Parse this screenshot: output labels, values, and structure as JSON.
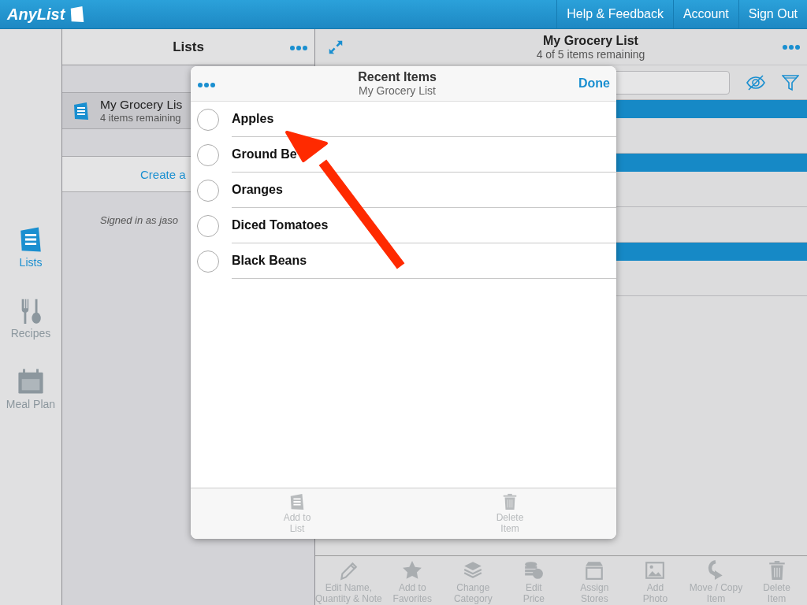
{
  "top_bar": {
    "logo": "AnyList",
    "links": [
      "Help & Feedback",
      "Account",
      "Sign Out"
    ]
  },
  "nav": [
    {
      "label": "Lists",
      "selected": true
    },
    {
      "label": "Recipes",
      "selected": false
    },
    {
      "label": "Meal Plan",
      "selected": false
    }
  ],
  "lists_pane": {
    "title": "Lists",
    "lists": [
      {
        "name": "My Grocery Lis",
        "subtitle": "4 items remaining",
        "selected": true
      }
    ],
    "create_link": "Create a",
    "signed_in": "Signed in as jaso"
  },
  "detail": {
    "title": "My Grocery List",
    "subtitle": "4 of 5 items remaining",
    "rows": [
      {
        "kind": "header"
      },
      {
        "kind": "item"
      },
      {
        "kind": "header"
      },
      {
        "kind": "item"
      },
      {
        "kind": "item"
      },
      {
        "kind": "header"
      },
      {
        "kind": "item"
      }
    ],
    "toolbar": [
      {
        "label": "Edit Name,\nQuantity & Note",
        "disabled": true
      },
      {
        "label": "Add to\nFavorites",
        "disabled": true
      },
      {
        "label": "Change\nCategory",
        "disabled": true
      },
      {
        "label": "Edit\nPrice",
        "disabled": true
      },
      {
        "label": "Assign\nStores",
        "disabled": true
      },
      {
        "label": "Add\nPhoto",
        "disabled": true
      },
      {
        "label": "Move / Copy\nItem",
        "disabled": true
      },
      {
        "label": "Delete\nItem",
        "disabled": true
      }
    ]
  },
  "recent_items": {
    "title": "Recent Items",
    "subtitle": "My Grocery List",
    "done": "Done",
    "items": [
      {
        "name": "Apples",
        "checked": false
      },
      {
        "name": "Ground Be",
        "checked": false
      },
      {
        "name": "Oranges",
        "checked": false
      },
      {
        "name": "Diced Tomatoes",
        "checked": false
      },
      {
        "name": "Black Beans",
        "checked": false
      }
    ],
    "footer": [
      {
        "label": "Add to\nList",
        "disabled": true
      },
      {
        "label": "Delete\nItem",
        "disabled": true
      }
    ]
  },
  "annotation": {
    "kind": "arrow"
  }
}
